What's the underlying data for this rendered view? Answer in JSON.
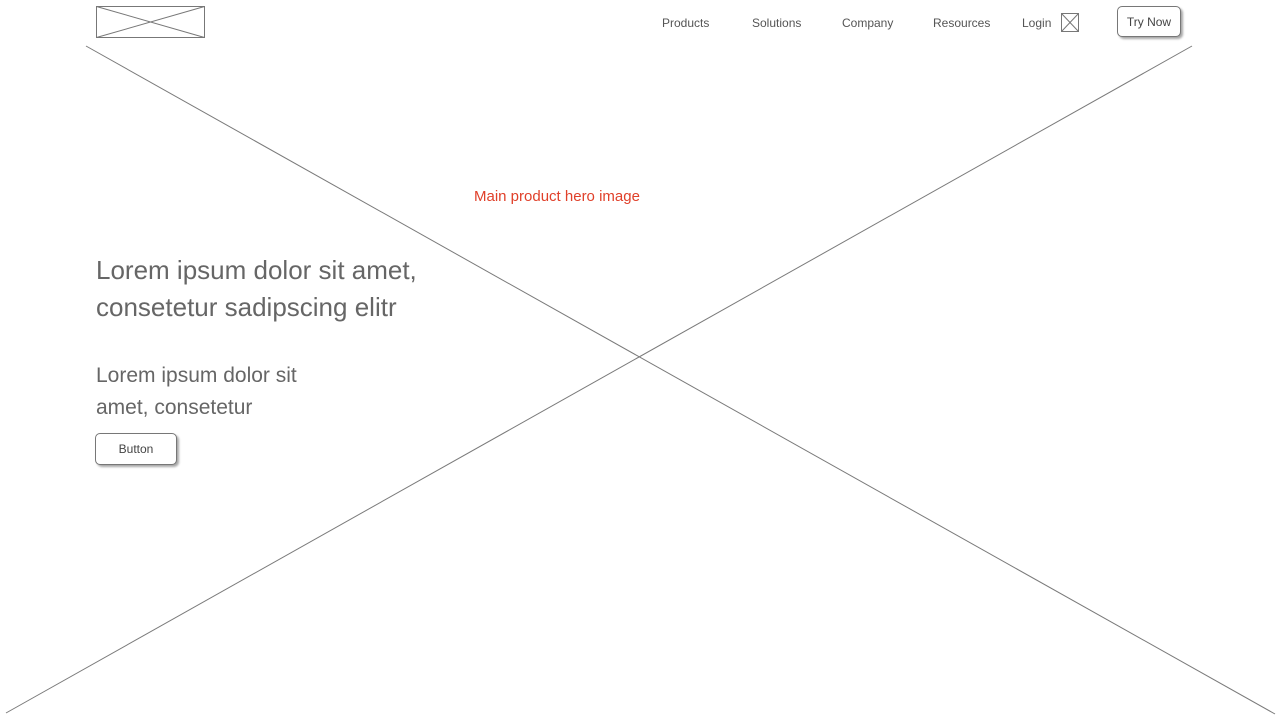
{
  "header": {
    "nav_items": [
      {
        "label": "Products"
      },
      {
        "label": "Solutions"
      },
      {
        "label": "Company"
      },
      {
        "label": "Resources"
      },
      {
        "label": "Login"
      }
    ],
    "cta_label": "Try Now"
  },
  "hero": {
    "image_caption": "Main product hero image",
    "headline": "Lorem ipsum dolor sit amet, consetetur sadipscing elitr",
    "subheadline": "Lorem ipsum dolor sit amet, consetetur",
    "button_label": "Button"
  },
  "colors": {
    "caption": "#e0402a",
    "text": "#666666",
    "placeholder_lines": "#777777"
  }
}
